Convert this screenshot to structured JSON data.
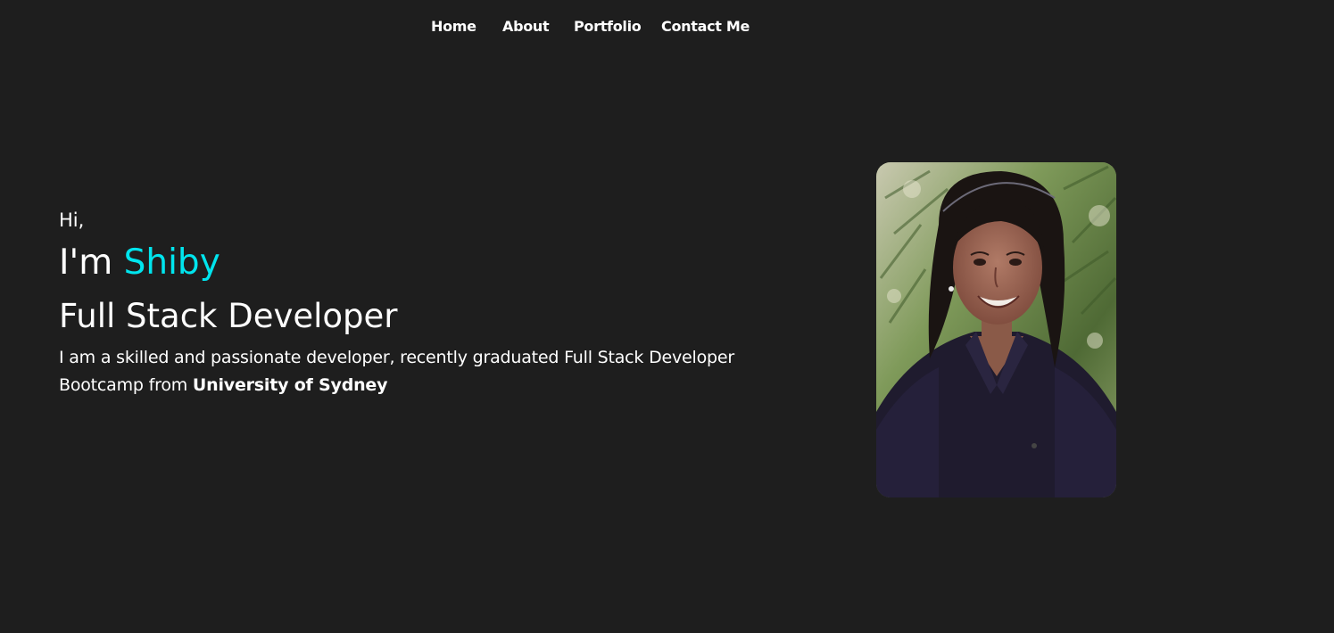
{
  "nav": {
    "items": [
      {
        "label": "Home"
      },
      {
        "label": "About"
      },
      {
        "label": "Portfolio"
      },
      {
        "label": "Contact Me"
      }
    ]
  },
  "hero": {
    "greeting": "Hi,",
    "intro_prefix": "I'm ",
    "name": "Shiby",
    "role": "Full Stack Developer",
    "bio_text": "I am a skilled and passionate developer, recently graduated Full Stack Developer Bootcamp from ",
    "bio_highlight": "University of Sydney"
  },
  "colors": {
    "background": "#1e1e1e",
    "text": "#ffffff",
    "accent": "#00e5ee"
  },
  "icons": {
    "profile_photo": "portrait-photo"
  }
}
